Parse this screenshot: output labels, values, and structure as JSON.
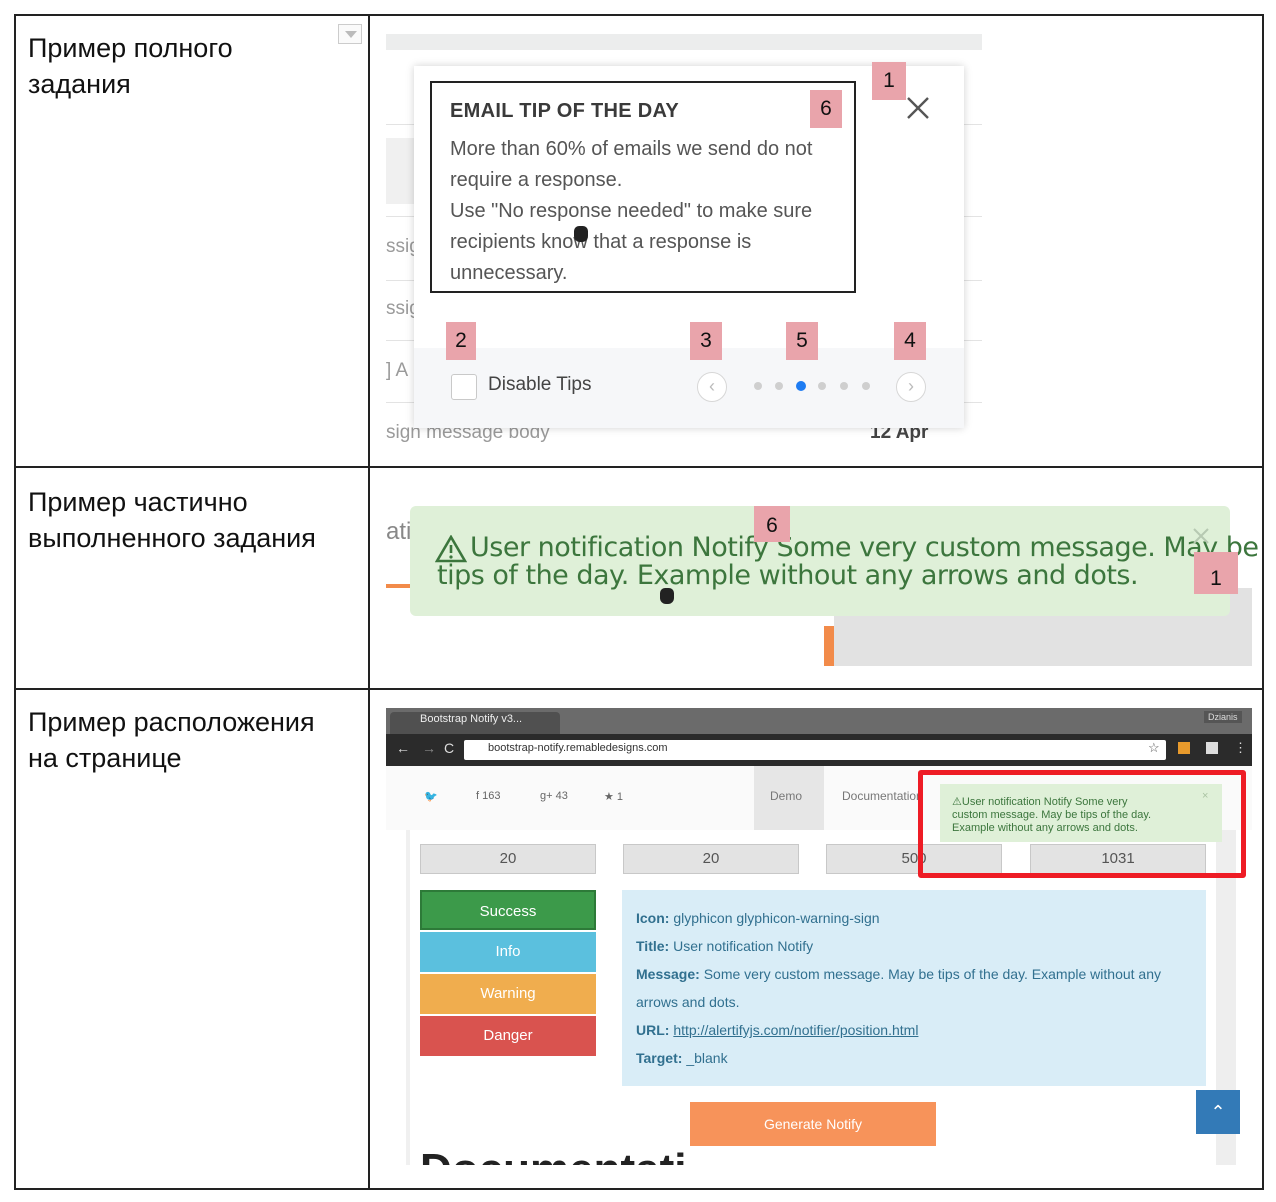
{
  "rows": [
    {
      "label": "Пример полного задания"
    },
    {
      "label": "Пример частично выполненного задания"
    },
    {
      "label": "Пример расположения на странице"
    }
  ],
  "row_labels_lines": [
    [
      "Пример полного",
      "задания"
    ],
    [
      "Пример частично",
      "выполненного задания"
    ],
    [
      "Пример расположения",
      "на странице"
    ]
  ],
  "panel1": {
    "title": "EMAIL TIP OF THE DAY",
    "lines": [
      "More than 60% of emails we send do not",
      "require a response.",
      "Use \"No response needed\" to make sure",
      "recipients know that a response is",
      "unnecessary."
    ],
    "disable_tips": "Disable Tips",
    "bg_fragments": [
      "ssig",
      "ssig",
      "] A",
      "sign message body",
      "12 Apr"
    ],
    "markers": [
      "1",
      "2",
      "3",
      "4",
      "5",
      "6"
    ],
    "colors": {
      "marker_bg": "#e9a4ab",
      "active_dot": "#1e7cf2"
    }
  },
  "panel2": {
    "line1": "User notification Notify Some very custom message. May be",
    "line2": "tips of the day. Example without any arrows and dots.",
    "bg_fragment": "ati",
    "markers": [
      "6",
      "1"
    ],
    "colors": {
      "notif_bg": "#dff0d8",
      "notif_text": "#3c763d"
    }
  },
  "panel3": {
    "tab_title": "Bootstrap Notify v3...",
    "url": "bootstrap-notify.remabledesigns.com",
    "window_label": "Dzianis",
    "social": [
      "163",
      "43",
      "1"
    ],
    "nav": [
      "Demo",
      "Documentation"
    ],
    "number_boxes": [
      "20",
      "20",
      "500",
      "1031"
    ],
    "buttons": [
      "Success",
      "Info",
      "Warning",
      "Danger"
    ],
    "info": {
      "icon_label": "Icon:",
      "icon_value": "glyphicon glyphicon-warning-sign",
      "title_label": "Title:",
      "title_value": "User notification Notify",
      "message_label": "Message:",
      "message_value": "Some very custom message. May be tips of the day. Example without any",
      "message_value2": "arrows and dots.",
      "url_label": "URL:",
      "url_value": "http://alertifyjs.com/notifier/position.html",
      "target_label": "Target:",
      "target_value": "_blank"
    },
    "mini_notif": [
      "User notification Notify Some very",
      "custom message. May be tips of the day.",
      "Example without any arrows and dots."
    ],
    "generate": "Generate Notify",
    "bottom_heading": "Documentati",
    "colors": {
      "success": "#3c9a4a",
      "info": "#5bc0de",
      "warning": "#f0ad4e",
      "danger": "#d9534f",
      "generate": "#f7935a",
      "highlight": "#ee1c25",
      "scroll_btn": "#337ab7"
    }
  }
}
